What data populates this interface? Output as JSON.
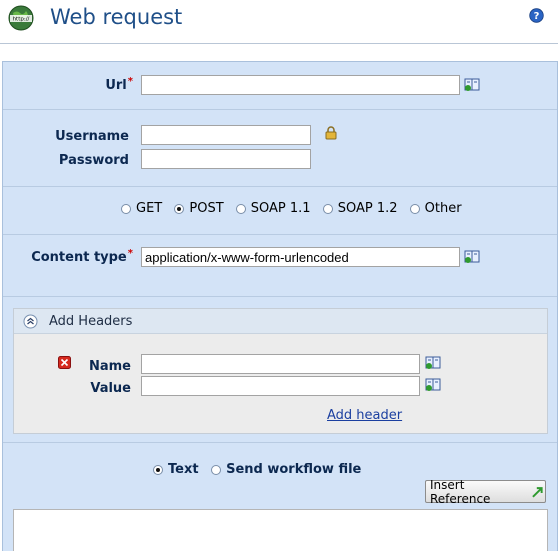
{
  "header": {
    "title": "Web request",
    "app_icon_text": "http://"
  },
  "url": {
    "label": "Url",
    "required_mark": "*",
    "value": ""
  },
  "credentials": {
    "username_label": "Username",
    "username_value": "",
    "password_label": "Password",
    "password_value": ""
  },
  "methods": {
    "options": [
      {
        "label": "GET",
        "checked": false
      },
      {
        "label": "POST",
        "checked": true
      },
      {
        "label": "SOAP 1.1",
        "checked": false
      },
      {
        "label": "SOAP 1.2",
        "checked": false
      },
      {
        "label": "Other",
        "checked": false
      }
    ]
  },
  "content_type": {
    "label": "Content type",
    "required_mark": "*",
    "value": "application/x-www-form-urlencoded"
  },
  "headers": {
    "title": "Add Headers",
    "name_label": "Name",
    "name_value": "",
    "value_label": "Value",
    "value_value": "",
    "add_link": "Add header"
  },
  "body_mode": {
    "options": [
      {
        "label": "Text",
        "checked": true
      },
      {
        "label": "Send workflow file",
        "checked": false
      }
    ]
  },
  "insert_reference": {
    "label": "Insert Reference"
  },
  "colors": {
    "title": "#1f4f88",
    "panel_bg": "#d3e3f7",
    "label": "#0c2850",
    "required": "#cc0000",
    "link": "#1b3fa0"
  }
}
